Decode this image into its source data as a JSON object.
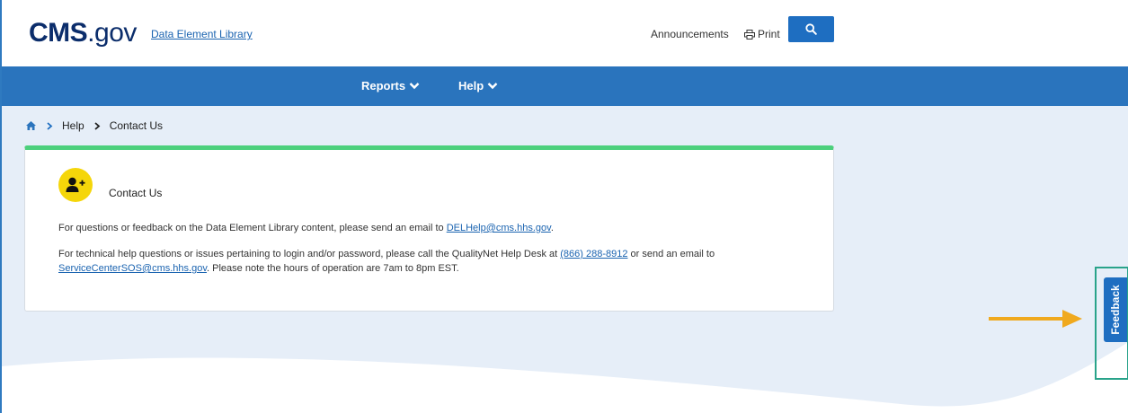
{
  "header": {
    "logo_bold": "CMS",
    "logo_rest": ".gov",
    "site_link": "Data Element Library",
    "announcements": "Announcements",
    "print": "Print"
  },
  "nav": {
    "items": [
      {
        "label": "Reports"
      },
      {
        "label": "Help"
      }
    ]
  },
  "breadcrumb": {
    "items": [
      "Help",
      "Contact Us"
    ]
  },
  "card": {
    "title": "Contact Us",
    "para1_text": "For questions or feedback on the Data Element Library content, please send an email to ",
    "para1_email": "DELHelp@cms.hhs.gov",
    "para1_end": ".",
    "para2_text": "For technical help questions or issues pertaining to login and/or password, please call the QualityNet Help Desk at ",
    "para2_phone": "(866) 288-8912",
    "para2_mid": " or send an email to",
    "para2_email": "ServiceCenterSOS@cms.hhs.gov",
    "para2_end": ". Please note the hours of operation are 7am to 8pm EST."
  },
  "feedback": {
    "label": "Feedback"
  },
  "colors": {
    "nav_blue": "#2a74bd",
    "accent_green": "#4cd07c",
    "avatar_yellow": "#f5d60a",
    "annotation_arrow": "#f0a91e",
    "annotation_box": "#29a38a"
  }
}
